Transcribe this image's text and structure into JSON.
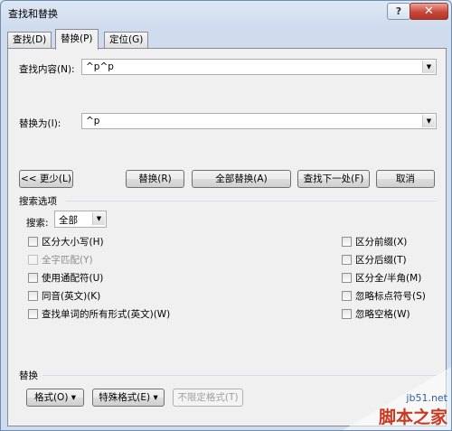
{
  "window": {
    "title": "查找和替换",
    "help": "?",
    "close": "✕"
  },
  "tabs": [
    {
      "label": "查找(D)"
    },
    {
      "label": "替换(P)"
    },
    {
      "label": "定位(G)"
    }
  ],
  "find": {
    "label": "查找内容(N):",
    "value": "^p^p"
  },
  "replace": {
    "label": "替换为(I):",
    "value": "^p"
  },
  "buttons": {
    "less": "<< 更少(L)",
    "replace": "替换(R)",
    "replace_all": "全部替换(A)",
    "find_next": "查找下一处(F)",
    "cancel": "取消"
  },
  "options": {
    "section_title": "搜索选项",
    "search_label": "搜索:",
    "search_value": "全部",
    "left": [
      {
        "label": "区分大小写(H)",
        "checked": false,
        "enabled": true
      },
      {
        "label": "全字匹配(Y)",
        "checked": false,
        "enabled": false
      },
      {
        "label": "使用通配符(U)",
        "checked": false,
        "enabled": true
      },
      {
        "label": "同音(英文)(K)",
        "checked": false,
        "enabled": true
      },
      {
        "label": "查找单词的所有形式(英文)(W)",
        "checked": false,
        "enabled": true
      }
    ],
    "right": [
      {
        "label": "区分前缀(X)",
        "checked": false,
        "enabled": true
      },
      {
        "label": "区分后缀(T)",
        "checked": false,
        "enabled": true
      },
      {
        "label": "区分全/半角(M)",
        "checked": false,
        "enabled": true
      },
      {
        "label": "忽略标点符号(S)",
        "checked": false,
        "enabled": true
      },
      {
        "label": "忽略空格(W)",
        "checked": false,
        "enabled": true
      }
    ]
  },
  "replace_section": {
    "title": "替换",
    "format": "格式(O) ▾",
    "special": "特殊格式(E) ▾",
    "no_format": "不限定格式(T)"
  },
  "watermark": {
    "site": "jb51.net",
    "brand": "脚本之家"
  }
}
